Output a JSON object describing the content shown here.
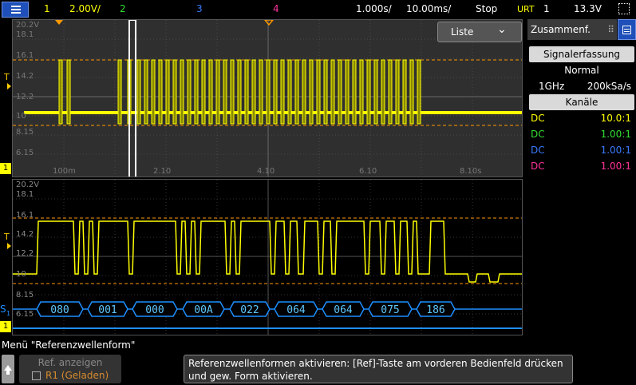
{
  "top_bar": {
    "ch1_label": "1",
    "ch1_scale": "2.00V/",
    "ch2_label": "2",
    "ch3_label": "3",
    "ch4_label": "4",
    "time_per_div": "1.000s/",
    "time_delay": "10.00ms/",
    "run_state": "Stop",
    "trigger_type": "URT",
    "trigger_source": "1",
    "trigger_level": "13.3V"
  },
  "upper_pane": {
    "list_button": "Liste",
    "y_labels": [
      "20.2V",
      "18.1",
      "16.1",
      "14.2",
      "12.2",
      "10",
      "8.15",
      "6.15"
    ],
    "x_labels": [
      "100m",
      "2.10",
      "4.10",
      "6.10",
      "8.10s"
    ]
  },
  "lower_pane": {
    "y_labels": [
      "20.2V",
      "18.1",
      "16.1",
      "14.2",
      "12.2",
      "10",
      "8.15",
      "6.15"
    ],
    "serial_label": "S",
    "serial_sub": "1",
    "decode_values": [
      "080",
      "001",
      "000",
      "00A",
      "022",
      "064",
      "064",
      "075",
      "186"
    ]
  },
  "markers": {
    "trigger_T_upper": "T",
    "trigger_T_lower": "T",
    "ch1_upper": "1",
    "ch1_lower": "1"
  },
  "sidebar": {
    "tab_label": "Zusammenf.",
    "acq_header": "Signalerfassung",
    "acq_mode": "Normal",
    "bandwidth": "1GHz",
    "sample_rate": "200kSa/s",
    "channels_header": "Kanäle",
    "channels": [
      {
        "coupling": "DC",
        "probe": "10.0:1",
        "color": "#ffff00"
      },
      {
        "coupling": "DC",
        "probe": "1.00:1",
        "color": "#33dd33"
      },
      {
        "coupling": "DC",
        "probe": "1.00:1",
        "color": "#3a7aff"
      },
      {
        "coupling": "DC",
        "probe": "1.00:1",
        "color": "#ff3399"
      }
    ]
  },
  "bottom": {
    "menu_title": "Menü \"Referenzwellenform\"",
    "softkey_label": "Ref. anzeigen",
    "softkey_value": "R1 (Geladen)",
    "message": "Referenzwellenformen aktivieren: [Ref]-Taste am vorderen Bedienfeld drücken und gew. Form aktivieren."
  },
  "colors": {
    "ch1": "#ffff00",
    "ch2": "#33dd33",
    "ch3": "#3a7aff",
    "ch4": "#ff3399",
    "serial": "#1e8fff",
    "trigger_marker": "#ff9900",
    "accent": "#1f4fb8"
  }
}
